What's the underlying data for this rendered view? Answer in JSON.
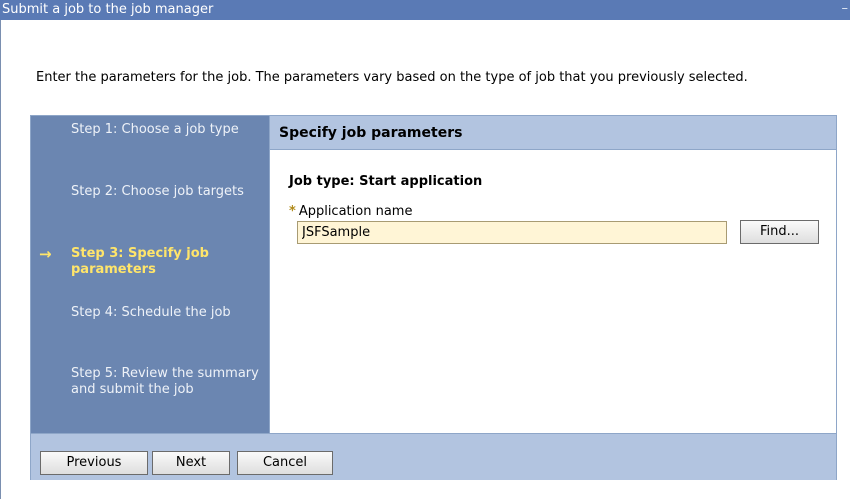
{
  "window": {
    "title": "Submit a job to the job manager"
  },
  "intro": "Enter the parameters for the job. The parameters vary based on the type of job that you previously selected.",
  "steps": [
    {
      "label": "Step 1: Choose a job type"
    },
    {
      "label": "Step 2: Choose job targets"
    },
    {
      "label": "Step 3: Specify job parameters",
      "current": true
    },
    {
      "label": "Step 4: Schedule the job"
    },
    {
      "label": "Step 5: Review the summary and submit the job"
    }
  ],
  "panel": {
    "heading": "Specify job parameters",
    "job_type": "Job type: Start application",
    "required_marker": "*",
    "app_name_label": "Application name",
    "app_name_value": "JSFSample",
    "find_button": "Find..."
  },
  "footer": {
    "previous": "Previous",
    "next": "Next",
    "cancel": "Cancel"
  },
  "icons": {
    "current_step_marker": "arrow-right-icon"
  },
  "colors": {
    "titlebar": "#5a7ab5",
    "sidebar": "#6b86b1",
    "header": "#b2c4e0",
    "current_step": "#ffe56a",
    "input_bg": "#fff5d6"
  }
}
